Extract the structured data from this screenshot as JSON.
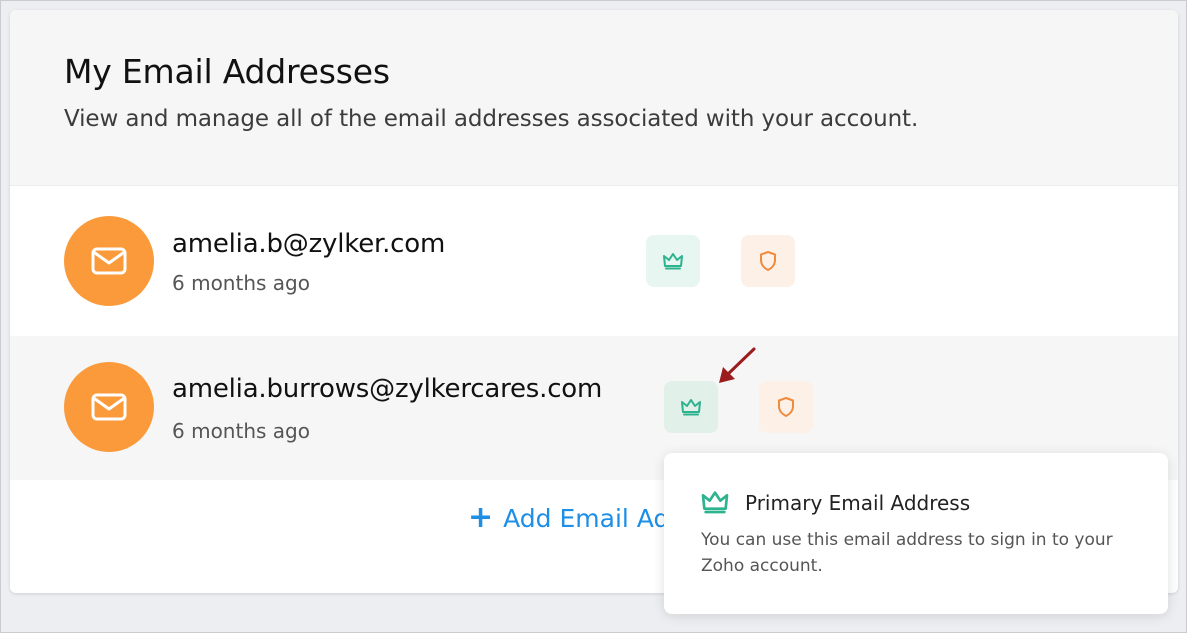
{
  "header": {
    "title": "My Email Addresses",
    "subtitle": "View and manage all of the email addresses associated with your account."
  },
  "emails": [
    {
      "address": "amelia.b@zylker.com",
      "added": "6 months ago"
    },
    {
      "address": "amelia.burrows@zylkercares.com",
      "added": "6 months ago"
    }
  ],
  "actions": {
    "add_label": "Add Email Address"
  },
  "tooltip": {
    "title": "Primary Email Address",
    "body": "You can use this email address to sign in to your Zoho account."
  },
  "icons": {
    "avatar": "mail-icon",
    "primary": "crown-icon",
    "secure": "shield-icon"
  },
  "colors": {
    "accent": "#1d8fe6",
    "avatar": "#fb9a3a",
    "primary_icon": "#2db38f",
    "secure_icon": "#f08a3c",
    "annotation_arrow": "#9b1c1c"
  }
}
